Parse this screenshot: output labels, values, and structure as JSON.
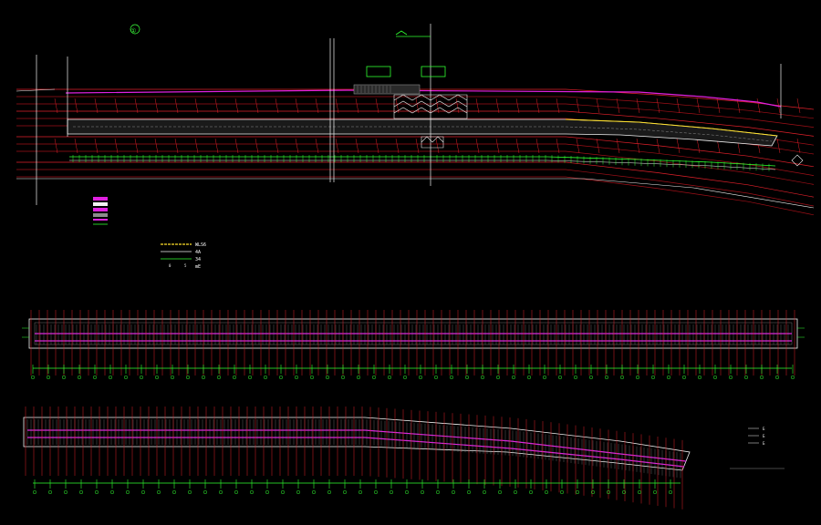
{
  "drawing": {
    "background": "#000000",
    "colors": {
      "road_red": "#e0202a",
      "dark_red": "#a01018",
      "magenta": "#e020e0",
      "green": "#30ff30",
      "white": "#f2f2f2",
      "yellow": "#ffe02a",
      "gray": "#8c8c8c"
    },
    "plan": {
      "marker_symbol": "①"
    },
    "legend_main": {
      "items": [
        "",
        "",
        "",
        "",
        "",
        ""
      ]
    },
    "legend_small": {
      "items": [
        "WLS6",
        "4A",
        "34",
        "mE"
      ],
      "scale_marks": [
        "0",
        "5"
      ]
    },
    "elevation_legend": {
      "items": [
        "Б",
        "Б",
        "Б"
      ]
    },
    "icons": [
      "north-arrow-icon",
      "section-marker-icon"
    ]
  }
}
